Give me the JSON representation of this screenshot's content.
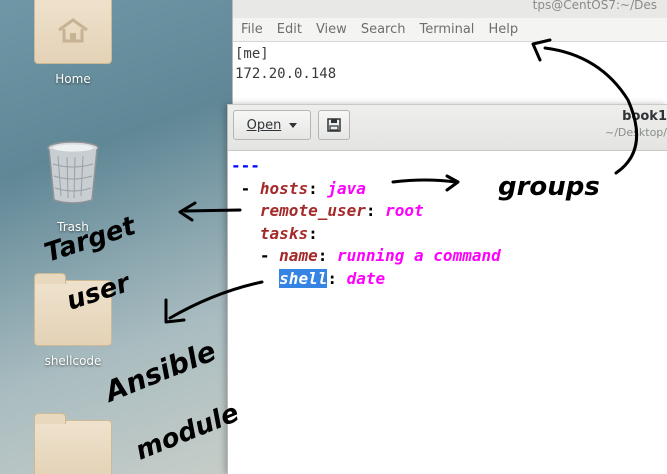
{
  "desktop": {
    "icons": [
      {
        "label": "Home"
      },
      {
        "label": "Trash"
      },
      {
        "label": "shellcode"
      },
      {
        "label": ""
      }
    ]
  },
  "terminal": {
    "title": "tps@CentOS7:~/Des",
    "menu": [
      "File",
      "Edit",
      "View",
      "Search",
      "Terminal",
      "Help"
    ],
    "lines": [
      "[me]",
      "172.20.0.148"
    ]
  },
  "editor": {
    "open_label": "Open",
    "title": "book1",
    "path": "~/Desktop/",
    "code": {
      "doc_start": "---",
      "hosts_key": "hosts",
      "hosts_val": "java",
      "remote_user_key": "remote_user",
      "remote_user_val": "root",
      "tasks_key": "tasks",
      "name_key": "name",
      "name_val": "running a command",
      "shell_key": "shell",
      "shell_val": "date"
    }
  },
  "annotations": {
    "groups": "groups",
    "target_user_1": "Target",
    "target_user_2": "user",
    "ansible_1": "Ansible",
    "ansible_2": "module"
  },
  "colors": {
    "yaml_key": "#a52a2a",
    "yaml_value": "#ff00ff",
    "yaml_doc_start": "#0000ff",
    "selection": "#3584e4"
  }
}
